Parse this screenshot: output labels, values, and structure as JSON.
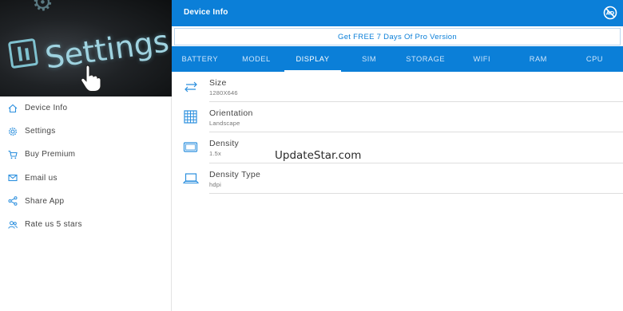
{
  "drawer": {
    "header_image_text": "Settings",
    "items": [
      {
        "label": "Device Info",
        "icon": "home-icon"
      },
      {
        "label": "Settings",
        "icon": "gear-icon"
      },
      {
        "label": "Buy Premium",
        "icon": "cart-icon"
      },
      {
        "label": "Email us",
        "icon": "mail-icon"
      },
      {
        "label": "Share App",
        "icon": "share-icon"
      },
      {
        "label": "Rate us 5 stars",
        "icon": "people-icon"
      }
    ]
  },
  "appbar": {
    "title": "Device Info",
    "right_icon": "no-ads-icon"
  },
  "promo": {
    "label": "Get FREE 7 Days Of Pro Version"
  },
  "tabs": {
    "active": "DISPLAY",
    "items": [
      "BATTERY",
      "MODEL",
      "DISPLAY",
      "SIM",
      "STORAGE",
      "WIFI",
      "RAM",
      "CPU"
    ]
  },
  "display": {
    "rows": [
      {
        "name": "Size",
        "value": "1280X646",
        "icon": "resize-arrows-icon"
      },
      {
        "name": "Orientation",
        "value": "Landscape",
        "icon": "grid-icon"
      },
      {
        "name": "Density",
        "value": "1.5x",
        "icon": "monitor-icon"
      },
      {
        "name": "Density Type",
        "value": "hdpi",
        "icon": "laptop-icon"
      }
    ]
  },
  "watermark": "UpdateStar.com",
  "colors": {
    "primary": "#0b7fd8",
    "icon_blue": "#2b8fde",
    "text_dark": "#444444",
    "text_muted": "#777777"
  }
}
